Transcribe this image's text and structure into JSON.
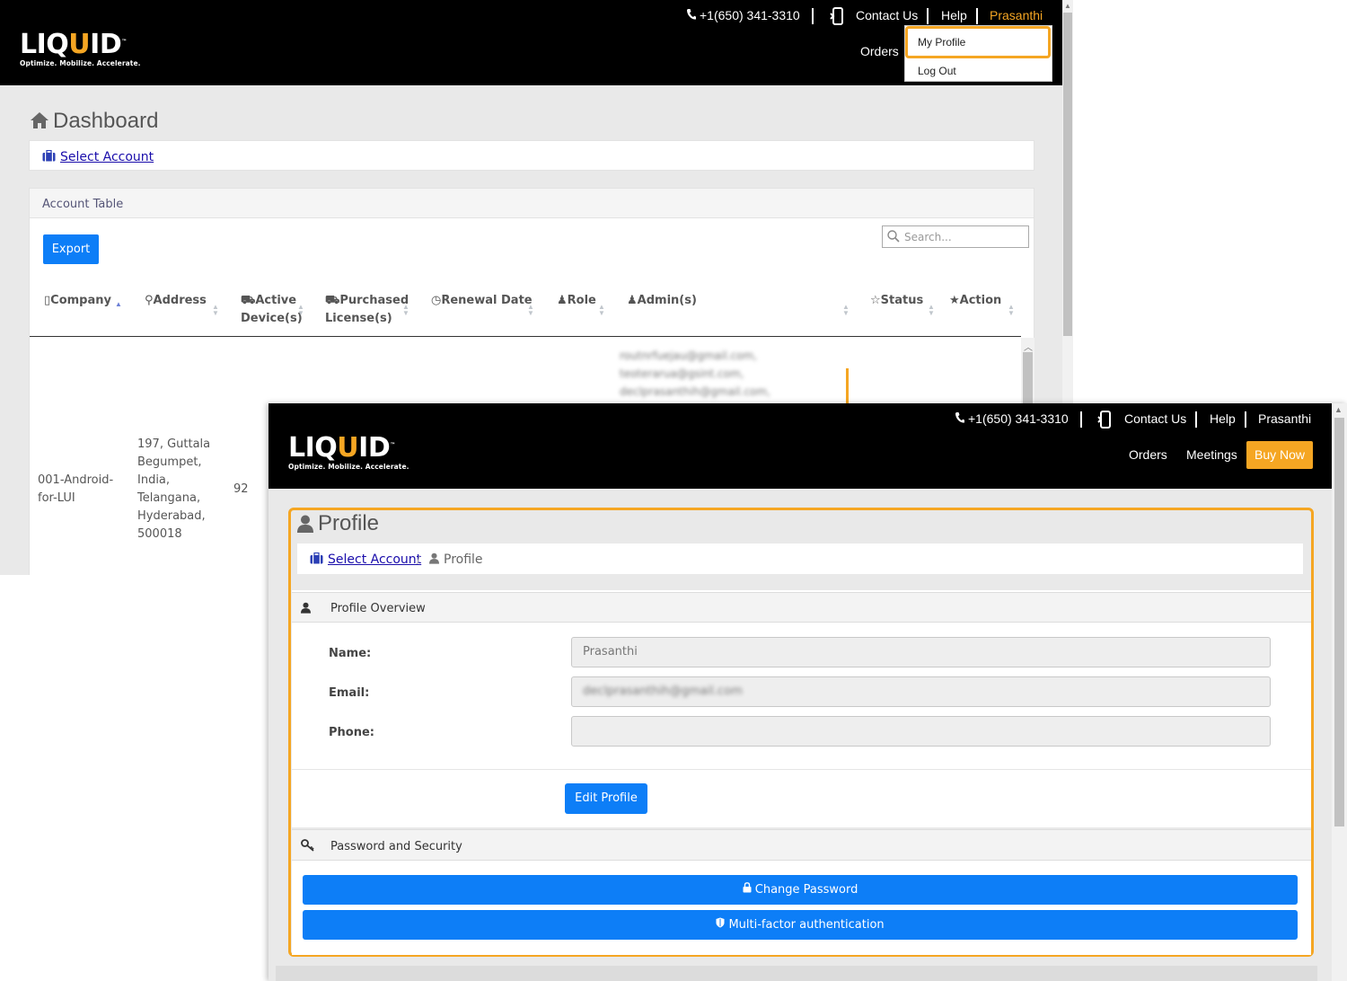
{
  "colors": {
    "accent": "#f5a623",
    "primary_button": "#0d7ef7",
    "header_bg": "#000000",
    "link": "#1a0dab"
  },
  "dashboard": {
    "header": {
      "logo_word_start": "LIQ",
      "logo_word_u": "U",
      "logo_word_end": "ID",
      "logo_tm": "™",
      "logo_tagline": "Optimize. Mobilize. Accelerate.",
      "phone_icon": "phone-icon",
      "phone": "+1(650) 341-3310",
      "contact_icon": "mobile-device-icon",
      "contact": "Contact Us",
      "help": "Help",
      "user": "Prasanthi",
      "orders": "Orders"
    },
    "user_menu": {
      "items": [
        "My Profile",
        "Log Out"
      ],
      "highlighted": "My Profile"
    },
    "title_icon": "home-icon",
    "title": "Dashboard",
    "select_account_icon": "briefcase-icon",
    "select_account": "Select Account",
    "table_panel": {
      "title": "Account Table",
      "export": "Export",
      "search_placeholder": "Search...",
      "columns": [
        {
          "icon": "building-icon",
          "label": "Company",
          "label2": ""
        },
        {
          "icon": "map-marker-icon",
          "label": "Address",
          "label2": ""
        },
        {
          "icon": "cart-icon",
          "label": "Active",
          "label2": "Device(s)"
        },
        {
          "icon": "cart-icon",
          "label": "Purchased",
          "label2": "License(s)"
        },
        {
          "icon": "clock-icon",
          "label": "Renewal Date",
          "label2": ""
        },
        {
          "icon": "user-icon",
          "label": "Role",
          "label2": ""
        },
        {
          "icon": "user-icon",
          "label": "Admin(s)",
          "label2": ""
        },
        {
          "icon": "star-half-icon",
          "label": "Status",
          "label2": ""
        },
        {
          "icon": "star-icon",
          "label": "Action",
          "label2": ""
        }
      ],
      "row": {
        "company": [
          "001-Android-",
          "for-LUI"
        ],
        "address": [
          "197, Guttala",
          "Begumpet,",
          "India,",
          "Telangana,",
          "Hyderabad,",
          "500018"
        ],
        "active_devices": "92",
        "admins": [
          "routnrfuejau@gmail.com,",
          "teoterarua@gsint.com,",
          "declprasanthih@gmail.com,"
        ]
      }
    }
  },
  "profile_page": {
    "header": {
      "phone": "+1(650) 341-3310",
      "contact": "Contact Us",
      "help": "Help",
      "user": "Prasanthi",
      "orders": "Orders",
      "meetings": "Meetings",
      "buy_now": "Buy Now"
    },
    "title_icon": "user-icon",
    "title": "Profile",
    "breadcrumb": {
      "select_account": "Select Account",
      "separator": "/",
      "current": "Profile"
    },
    "overview": {
      "heading": "Profile Overview",
      "name_label": "Name:",
      "name_value": "Prasanthi",
      "email_label": "Email:",
      "email_value": "declprasanthih@gmail.com",
      "phone_label": "Phone:",
      "phone_value": "",
      "edit_button": "Edit Profile"
    },
    "security": {
      "heading": "Password and Security",
      "heading_icon": "key-icon",
      "change_password": "Change Password",
      "change_password_icon": "lock-icon",
      "mfa": "Multi-factor authentication",
      "mfa_icon": "shield-icon"
    }
  }
}
